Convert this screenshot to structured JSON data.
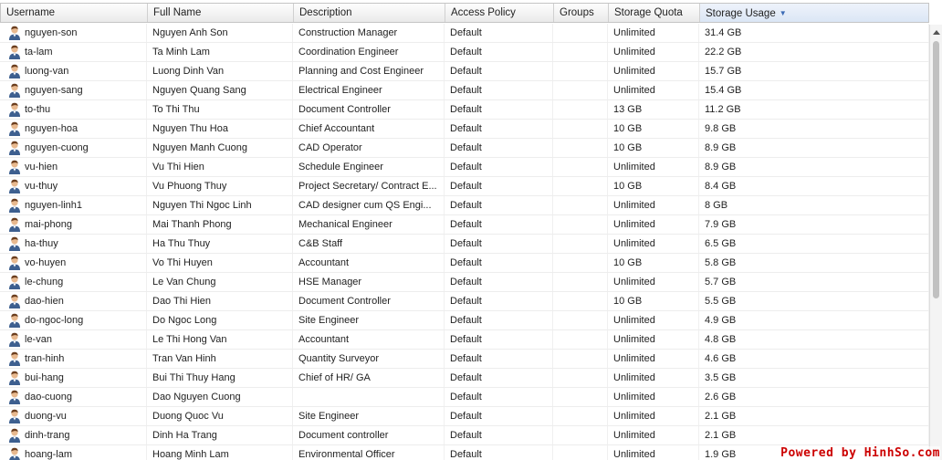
{
  "columns": {
    "username": "Username",
    "full_name": "Full Name",
    "description": "Description",
    "access_policy": "Access Policy",
    "groups": "Groups",
    "storage_quota": "Storage Quota",
    "storage_usage": "Storage Usage"
  },
  "sort": {
    "column": "storage_usage",
    "direction": "descending",
    "icon": "sort-desc-icon"
  },
  "rows": [
    {
      "username": "nguyen-son",
      "full_name": "Nguyen Anh Son",
      "description": "Construction Manager",
      "policy": "Default",
      "groups": "",
      "quota": "Unlimited",
      "usage": "31.4 GB"
    },
    {
      "username": "ta-lam",
      "full_name": "Ta Minh Lam",
      "description": "Coordination Engineer",
      "policy": "Default",
      "groups": "",
      "quota": "Unlimited",
      "usage": "22.2 GB"
    },
    {
      "username": "luong-van",
      "full_name": "Luong Dinh Van",
      "description": "Planning and Cost Engineer",
      "policy": "Default",
      "groups": "",
      "quota": "Unlimited",
      "usage": "15.7 GB"
    },
    {
      "username": "nguyen-sang",
      "full_name": "Nguyen Quang Sang",
      "description": "Electrical Engineer",
      "policy": "Default",
      "groups": "",
      "quota": "Unlimited",
      "usage": "15.4 GB"
    },
    {
      "username": "to-thu",
      "full_name": "To Thi Thu",
      "description": "Document Controller",
      "policy": "Default",
      "groups": "",
      "quota": "13 GB",
      "usage": "11.2 GB"
    },
    {
      "username": "nguyen-hoa",
      "full_name": "Nguyen Thu Hoa",
      "description": "Chief Accountant",
      "policy": "Default",
      "groups": "",
      "quota": "10 GB",
      "usage": "9.8 GB"
    },
    {
      "username": "nguyen-cuong",
      "full_name": "Nguyen Manh Cuong",
      "description": "CAD Operator",
      "policy": "Default",
      "groups": "",
      "quota": "10 GB",
      "usage": "8.9 GB"
    },
    {
      "username": "vu-hien",
      "full_name": "Vu Thi Hien",
      "description": "Schedule Engineer",
      "policy": "Default",
      "groups": "",
      "quota": "Unlimited",
      "usage": "8.9 GB"
    },
    {
      "username": "vu-thuy",
      "full_name": "Vu Phuong Thuy",
      "description": "Project Secretary/ Contract E...",
      "policy": "Default",
      "groups": "",
      "quota": "10 GB",
      "usage": "8.4 GB"
    },
    {
      "username": "nguyen-linh1",
      "full_name": "Nguyen Thi Ngoc Linh",
      "description": " CAD designer cum QS Engi...",
      "policy": "Default",
      "groups": "",
      "quota": "Unlimited",
      "usage": "8 GB"
    },
    {
      "username": "mai-phong",
      "full_name": "Mai Thanh Phong",
      "description": "Mechanical Engineer",
      "policy": "Default",
      "groups": "",
      "quota": "Unlimited",
      "usage": "7.9 GB"
    },
    {
      "username": "ha-thuy",
      "full_name": "Ha Thu Thuy",
      "description": "C&B Staff",
      "policy": "Default",
      "groups": "",
      "quota": "Unlimited",
      "usage": "6.5 GB"
    },
    {
      "username": "vo-huyen",
      "full_name": "Vo Thi Huyen",
      "description": "Accountant",
      "policy": "Default",
      "groups": "",
      "quota": "10 GB",
      "usage": "5.8 GB"
    },
    {
      "username": "le-chung",
      "full_name": "Le Van Chung",
      "description": "HSE Manager",
      "policy": "Default",
      "groups": "",
      "quota": "Unlimited",
      "usage": "5.7 GB"
    },
    {
      "username": "dao-hien",
      "full_name": "Dao Thi Hien",
      "description": "Document Controller",
      "policy": "Default",
      "groups": "",
      "quota": "10 GB",
      "usage": "5.5 GB"
    },
    {
      "username": "do-ngoc-long",
      "full_name": "Do Ngoc Long",
      "description": "Site Engineer",
      "policy": "Default",
      "groups": "",
      "quota": "Unlimited",
      "usage": "4.9 GB"
    },
    {
      "username": "le-van",
      "full_name": "Le Thi Hong Van",
      "description": "Accountant",
      "policy": "Default",
      "groups": "",
      "quota": "Unlimited",
      "usage": "4.8 GB"
    },
    {
      "username": "tran-hinh",
      "full_name": "Tran Van Hinh",
      "description": "Quantity Surveyor",
      "policy": "Default",
      "groups": "",
      "quota": "Unlimited",
      "usage": "4.6 GB"
    },
    {
      "username": "bui-hang",
      "full_name": "Bui Thi Thuy Hang",
      "description": "Chief of HR/ GA",
      "policy": "Default",
      "groups": "",
      "quota": "Unlimited",
      "usage": "3.5 GB"
    },
    {
      "username": "dao-cuong",
      "full_name": "Dao Nguyen Cuong",
      "description": "",
      "policy": "Default",
      "groups": "",
      "quota": "Unlimited",
      "usage": "2.6 GB"
    },
    {
      "username": "duong-vu",
      "full_name": "Duong Quoc Vu",
      "description": "Site Engineer",
      "policy": "Default",
      "groups": "",
      "quota": "Unlimited",
      "usage": "2.1 GB"
    },
    {
      "username": "dinh-trang",
      "full_name": "Dinh Ha Trang",
      "description": "Document controller",
      "policy": "Default",
      "groups": "",
      "quota": "Unlimited",
      "usage": "2.1 GB"
    },
    {
      "username": "hoang-lam",
      "full_name": "Hoang Minh Lam",
      "description": "Environmental Officer",
      "policy": "Default",
      "groups": "",
      "quota": "Unlimited",
      "usage": "1.9 GB"
    }
  ],
  "row_icon": "user-icon",
  "watermark": "Powered by HinhSo.com",
  "colors": {
    "sort_accent": "#3b6bb5",
    "watermark": "#cc0000",
    "row_border": "#ededed"
  }
}
